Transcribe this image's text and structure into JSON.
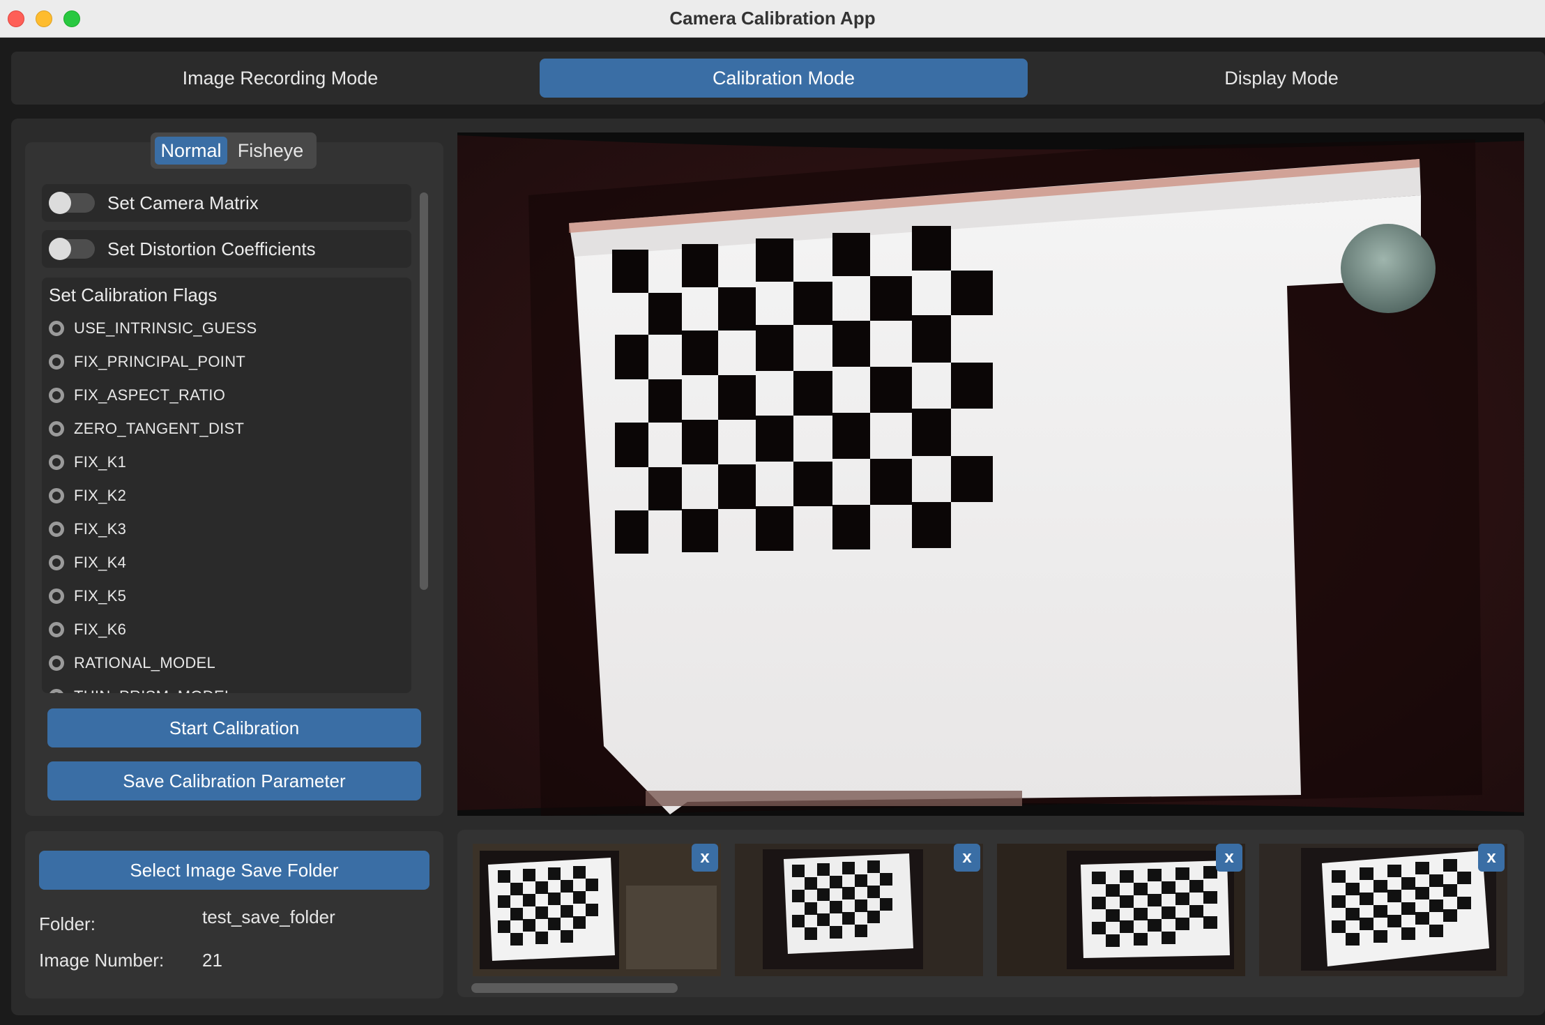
{
  "window": {
    "title": "Camera Calibration App"
  },
  "modes": {
    "tabs": [
      {
        "label": "Image Recording Mode",
        "active": false
      },
      {
        "label": "Calibration Mode",
        "active": true
      },
      {
        "label": "Display Mode",
        "active": false
      }
    ]
  },
  "lens_type": {
    "options": [
      "Normal",
      "Fisheye"
    ],
    "selected": "Normal"
  },
  "switches": [
    {
      "label": "Set Camera Matrix",
      "on": false
    },
    {
      "label": "Set Distortion Coefficients",
      "on": false
    }
  ],
  "flags": {
    "title": "Set Calibration Flags",
    "items": [
      "USE_INTRINSIC_GUESS",
      "FIX_PRINCIPAL_POINT",
      "FIX_ASPECT_RATIO",
      "ZERO_TANGENT_DIST",
      "FIX_K1",
      "FIX_K2",
      "FIX_K3",
      "FIX_K4",
      "FIX_K5",
      "FIX_K6",
      "RATIONAL_MODEL",
      "THIN_PRISM_MODEL"
    ]
  },
  "actions": {
    "start": "Start Calibration",
    "save": "Save Calibration Parameter"
  },
  "storage": {
    "select_button": "Select Image Save Folder",
    "folder_label": "Folder:",
    "folder_value": "test_save_folder",
    "count_label": "Image Number:",
    "count_value": "21"
  },
  "thumbnails": {
    "delete_label": "x",
    "count_visible": 4
  },
  "colors": {
    "accent": "#3a6ea5",
    "background": "#1b1b1b",
    "panel": "#333333"
  }
}
